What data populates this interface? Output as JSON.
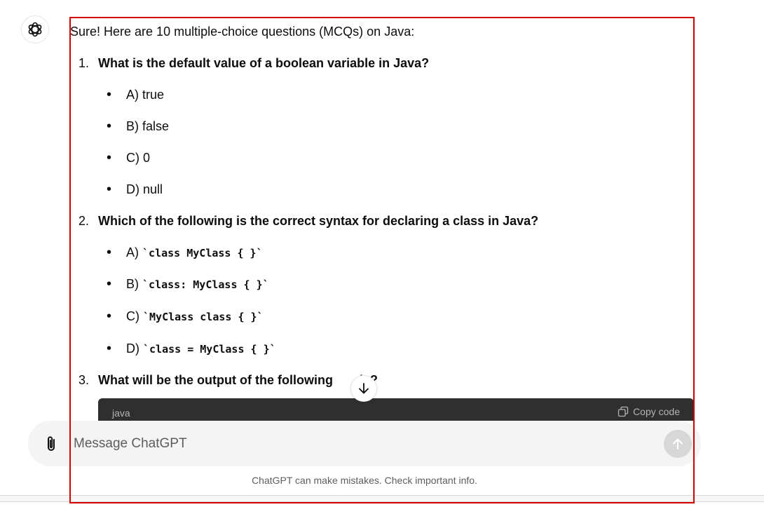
{
  "message": {
    "intro": "Sure! Here are 10 multiple-choice questions (MCQs) on Java:",
    "questions": [
      {
        "num": "1.",
        "text": "What is the default value of a boolean variable in Java?",
        "options": [
          {
            "prefix": "A) ",
            "text": "true"
          },
          {
            "prefix": "B) ",
            "text": "false"
          },
          {
            "prefix": "C) ",
            "text": "0"
          },
          {
            "prefix": "D) ",
            "text": "null"
          }
        ]
      },
      {
        "num": "2.",
        "text": "Which of the following is the correct syntax for declaring a class in Java?",
        "options": [
          {
            "prefix": "A) ",
            "code": "`class MyClass { }`"
          },
          {
            "prefix": "B) ",
            "code": "`class: MyClass { }`"
          },
          {
            "prefix": "C) ",
            "code": "`MyClass class { }`"
          },
          {
            "prefix": "D) ",
            "code": "`class = MyClass { }`"
          }
        ]
      },
      {
        "num": "3.",
        "text": "What will be the output of the following",
        "text_tail": "de?"
      }
    ],
    "codeblock": {
      "lang": "java",
      "copy_label": "Copy code"
    }
  },
  "composer": {
    "placeholder": "Message ChatGPT"
  },
  "footer": {
    "note": "ChatGPT can make mistakes. Check important info."
  }
}
